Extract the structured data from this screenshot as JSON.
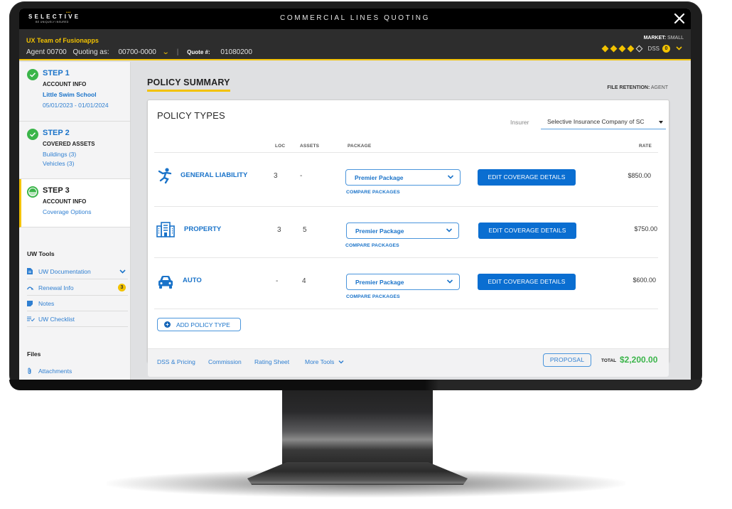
{
  "app": {
    "brand": "SELECTIVE",
    "brand_tagline": "BE UNIQUELY INSURED",
    "title": "COMMERCIAL LINES QUOTING"
  },
  "infobar": {
    "team": "UX Team of Fusionapps",
    "agent": "Agent 00700",
    "quoting_as_label": "Quoting as:",
    "quoting_as_value": "00700-0000",
    "quote_label": "Quote #:",
    "quote_number": "01080200",
    "market_label": "MARKET:",
    "market_value": "SMALL",
    "rating_filled": 4,
    "rating_total": 5,
    "dss_label": "DSS",
    "dss_count": "0"
  },
  "sidebar": {
    "steps": [
      {
        "title": "STEP 1",
        "subtitle": "ACCOUNT INFO",
        "links": [
          "Little Swim School",
          "05/01/2023 - 01/01/2024"
        ],
        "status": "complete"
      },
      {
        "title": "STEP 2",
        "subtitle": "COVERED ASSETS",
        "links": [
          "Buildings (3)",
          "Vehicles (3)"
        ],
        "status": "complete"
      },
      {
        "title": "STEP 3",
        "subtitle": "ACCOUNT INFO",
        "links": [
          "Coverage Options"
        ],
        "status": "in-progress"
      }
    ],
    "uw_tools_heading": "UW Tools",
    "uw_tools": [
      {
        "label": "UW Documentation",
        "icon": "document-icon"
      },
      {
        "label": "Renewal Info",
        "icon": "renewal-icon",
        "badge": "3"
      },
      {
        "label": "Notes",
        "icon": "note-icon"
      },
      {
        "label": "UW Checklist",
        "icon": "checklist-icon"
      }
    ],
    "files_heading": "Files",
    "files": [
      {
        "label": "Attachments",
        "icon": "paperclip-icon"
      }
    ]
  },
  "main": {
    "page_title": "POLICY SUMMARY",
    "file_retention_label": "FILE RETENTION:",
    "file_retention_value": "AGENT",
    "card_title": "POLICY TYPES",
    "insurer_label": "Insurer",
    "insurer_value": "Selective Insurance Company of SC",
    "columns": {
      "loc": "LOC",
      "assets": "ASSETS",
      "package": "PACKAGE",
      "rate": "RATE"
    },
    "policies": [
      {
        "name": "GENERAL LIABILITY",
        "icon": "person-falling-icon",
        "loc": "3",
        "assets": "-",
        "package": "Premier Package",
        "compare": "COMPARE PACKAGES",
        "edit": "EDIT COVERAGE DETAILS",
        "rate": "$850.00"
      },
      {
        "name": "PROPERTY",
        "icon": "building-icon",
        "loc": "3",
        "assets": "5",
        "package": "Premier Package",
        "compare": "COMPARE PACKAGES",
        "edit": "EDIT COVERAGE DETAILS",
        "rate": "$750.00"
      },
      {
        "name": "AUTO",
        "icon": "car-icon",
        "loc": "-",
        "assets": "4",
        "package": "Premier Package",
        "compare": "COMPARE PACKAGES",
        "edit": "EDIT COVERAGE DETAILS",
        "rate": "$600.00"
      }
    ],
    "add_policy_label": "ADD POLICY TYPE",
    "footer": {
      "links": [
        "DSS & Pricing",
        "Commission",
        "Rating Sheet",
        "More Tools"
      ],
      "proposal_label": "PROPOSAL",
      "total_label": "TOTAL",
      "total_value": "$2,200.00"
    }
  },
  "colors": {
    "accent_yellow": "#f2c200",
    "primary_blue": "#0a6ed1",
    "total_green": "#3bb54a",
    "complete_green": "#3bb54a"
  }
}
